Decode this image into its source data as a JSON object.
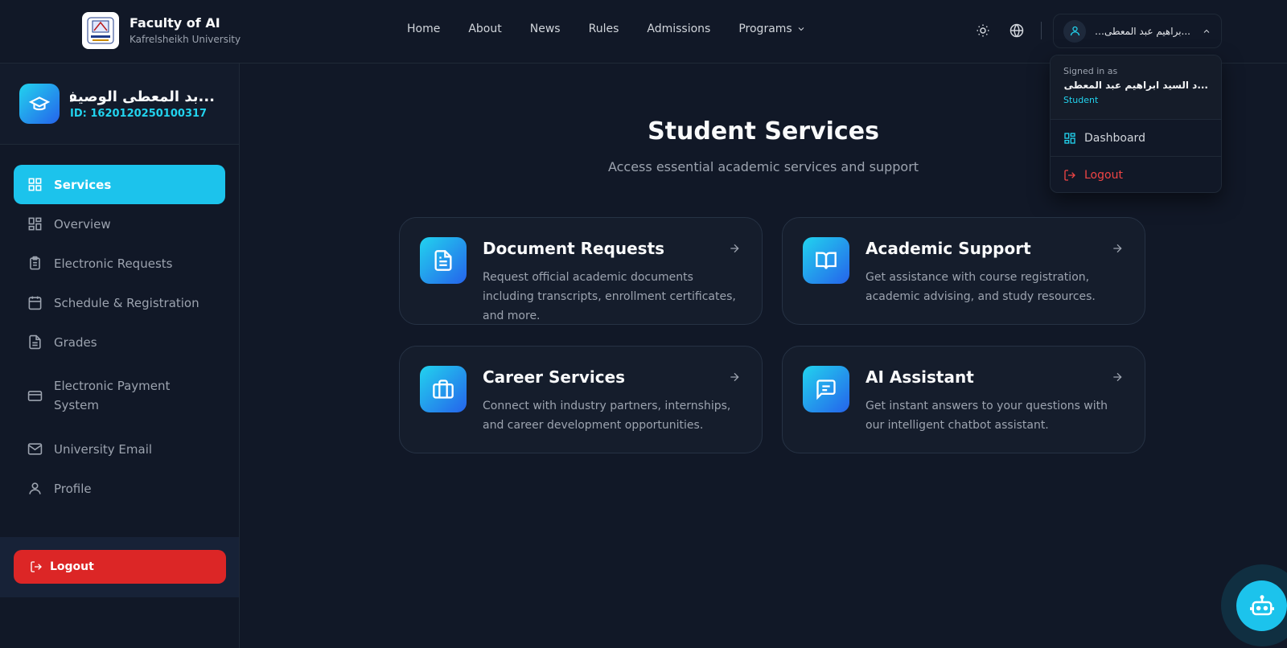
{
  "brand": {
    "title": "Faculty of AI",
    "subtitle": "Kafrelsheikh University"
  },
  "nav": {
    "items": [
      "Home",
      "About",
      "News",
      "Rules",
      "Admissions",
      "Programs"
    ]
  },
  "user_menu": {
    "name": "...براهيم عبد المعطى الوصيف",
    "signed_in_label": "Signed in as",
    "full_name": "...د السيد ابراهيم عبد المعطى الوصيف",
    "role": "Student",
    "items": {
      "dashboard": "Dashboard",
      "logout": "Logout"
    }
  },
  "sidebar": {
    "name": "...بد المعطى الوصيف",
    "id": "ID: 1620120250100317",
    "items": [
      {
        "label": "Services",
        "icon": "grid-icon"
      },
      {
        "label": "Overview",
        "icon": "layout-icon"
      },
      {
        "label": "Electronic Requests",
        "icon": "clipboard-icon"
      },
      {
        "label": "Schedule & Registration",
        "icon": "calendar-icon"
      },
      {
        "label": "Grades",
        "icon": "document-icon"
      },
      {
        "label": "Electronic Payment System",
        "icon": "credit-card-icon"
      },
      {
        "label": "University Email",
        "icon": "mail-icon"
      },
      {
        "label": "Profile",
        "icon": "user-icon"
      }
    ],
    "logout": "Logout"
  },
  "main": {
    "title": "Student Services",
    "subtitle": "Access essential academic services and support",
    "cards": [
      {
        "title": "Document Requests",
        "desc": "Request official academic documents including transcripts, enrollment certificates, and more."
      },
      {
        "title": "Academic Support",
        "desc": "Get assistance with course registration, academic advising, and study resources."
      },
      {
        "title": "Career Services",
        "desc": "Connect with industry partners, internships, and career development opportunities."
      },
      {
        "title": "AI Assistant",
        "desc": "Get instant answers to your questions with our intelligent chatbot assistant."
      }
    ]
  },
  "colors": {
    "accent": "#1cc3ec",
    "danger": "#dc2626",
    "background": "#111827"
  }
}
